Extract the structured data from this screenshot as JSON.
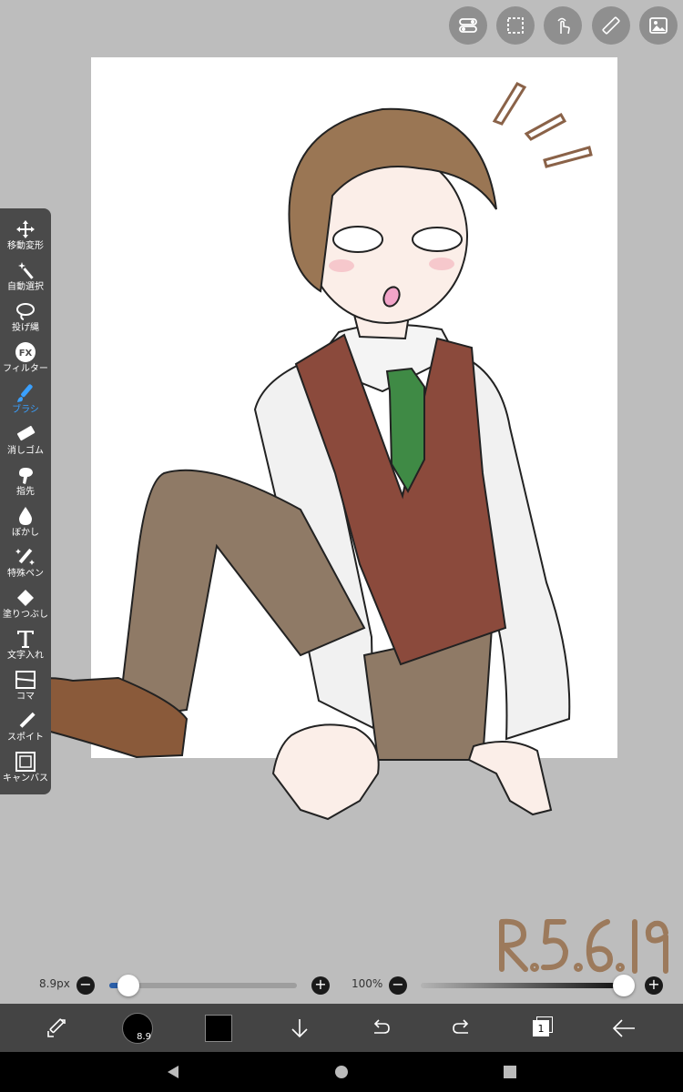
{
  "top_toolbar": {
    "buttons": [
      {
        "name": "toggle-icon"
      },
      {
        "name": "selection-icon"
      },
      {
        "name": "touch-gesture-icon"
      },
      {
        "name": "ruler-icon"
      },
      {
        "name": "image-icon"
      }
    ]
  },
  "tools": [
    {
      "label": "移動変形",
      "icon": "move-icon",
      "active": false
    },
    {
      "label": "自動選択",
      "icon": "magic-wand-icon",
      "active": false
    },
    {
      "label": "投げ縄",
      "icon": "lasso-icon",
      "active": false
    },
    {
      "label": "フィルター",
      "icon": "fx-icon",
      "active": false
    },
    {
      "label": "ブラシ",
      "icon": "brush-icon",
      "active": true
    },
    {
      "label": "消しゴム",
      "icon": "eraser-icon",
      "active": false
    },
    {
      "label": "指先",
      "icon": "finger-icon",
      "active": false
    },
    {
      "label": "ぼかし",
      "icon": "blur-drop-icon",
      "active": false
    },
    {
      "label": "特殊ペン",
      "icon": "special-pen-icon",
      "active": false
    },
    {
      "label": "塗りつぶし",
      "icon": "fill-bucket-icon",
      "active": false
    },
    {
      "label": "文字入れ",
      "icon": "text-icon",
      "active": false
    },
    {
      "label": "コマ",
      "icon": "frame-icon",
      "active": false
    },
    {
      "label": "スポイト",
      "icon": "eyedropper-icon",
      "active": false
    },
    {
      "label": "キャンバス",
      "icon": "canvas-icon",
      "active": false
    }
  ],
  "brush_size": {
    "label": "8.9px",
    "value": 8.9,
    "fraction": 0.1
  },
  "opacity": {
    "label": "100%",
    "value": 100,
    "fraction": 1.0
  },
  "bottom_bar": {
    "brush_preview_label": "8.9",
    "layer_count": "1",
    "current_color": "#000000"
  },
  "colors": {
    "background": "#bdbdbd",
    "palette": "#4a4a4a",
    "accent": "#3aa0ff",
    "slider_fill": "#2a5fa8"
  }
}
